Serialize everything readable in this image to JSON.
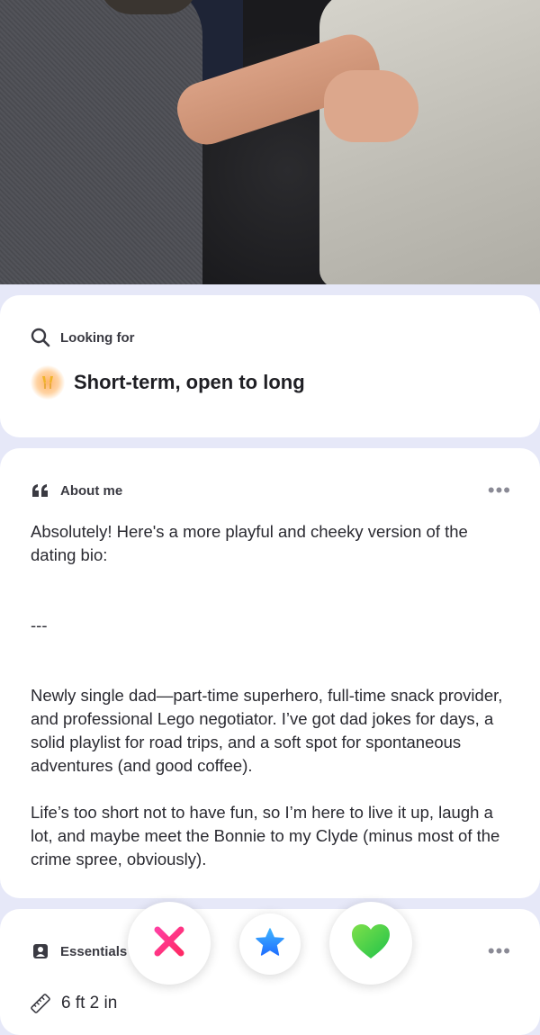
{
  "looking_for": {
    "label": "Looking for",
    "icon": "search-icon",
    "value": "Short-term, open to long",
    "value_icon": "champagne-icon"
  },
  "about_me": {
    "label": "About me",
    "icon": "quote-icon",
    "more_icon": "more-dots-icon",
    "paragraphs": [
      "Absolutely! Here's a more playful and cheeky version of the dating bio:",
      "---",
      "Newly single dad—part-time superhero, full-time snack provider, and professional Lego negotiator. I’ve got dad jokes for days, a solid playlist for road trips, and a soft spot for spontaneous adventures (and good coffee).",
      "Life’s too short not to have fun, so I’m here to live it up, laugh a lot, and maybe meet the Bonnie to my Clyde (minus most of  the crime spree, obviously)."
    ]
  },
  "essentials": {
    "label": "Essentials",
    "icon": "id-card-icon",
    "more_icon": "more-dots-icon",
    "height": "6 ft 2 in",
    "height_icon": "ruler-icon"
  },
  "actions": {
    "nope_icon": "x-icon",
    "super_like_icon": "star-icon",
    "like_icon": "heart-icon"
  },
  "colors": {
    "nope": "#ff2d87",
    "super_like": "#2f8cff",
    "like": "#3fd43a",
    "page_bg": "#e6e8f8"
  }
}
